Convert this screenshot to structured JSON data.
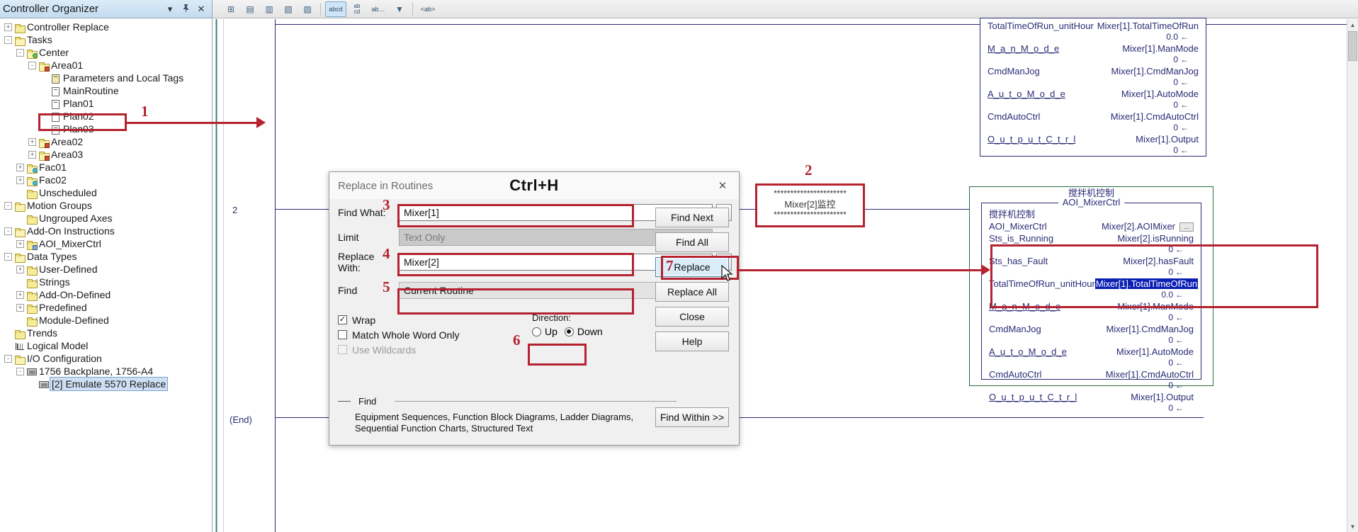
{
  "organizer": {
    "title": "Controller Organizer",
    "title_icons": [
      {
        "name": "dropdown-icon",
        "glyph": "▾"
      },
      {
        "name": "pin-icon",
        "glyph": "📌"
      },
      {
        "name": "close-icon",
        "glyph": "✕"
      }
    ],
    "tree": [
      {
        "label": "Controller Replace",
        "depth": 0,
        "exp": "+",
        "icon": "folder",
        "sel": false
      },
      {
        "label": "Tasks",
        "depth": 0,
        "exp": "-",
        "icon": "folder-open",
        "sel": false
      },
      {
        "label": "Center",
        "depth": 1,
        "exp": "-",
        "icon": "folder-task",
        "sel": false
      },
      {
        "label": "Area01",
        "depth": 2,
        "exp": "-",
        "icon": "folder-program",
        "sel": false
      },
      {
        "label": "Parameters and Local Tags",
        "depth": 3,
        "exp": "",
        "icon": "params",
        "sel": false
      },
      {
        "label": "MainRoutine",
        "depth": 3,
        "exp": "",
        "icon": "routine-main",
        "sel": false
      },
      {
        "label": "Plan01",
        "depth": 3,
        "exp": "",
        "icon": "routine",
        "sel": false
      },
      {
        "label": "Plan02",
        "depth": 3,
        "exp": "",
        "icon": "routine",
        "sel": false
      },
      {
        "label": "Plan03",
        "depth": 3,
        "exp": "",
        "icon": "routine",
        "sel": false
      },
      {
        "label": "Area02",
        "depth": 2,
        "exp": "+",
        "icon": "folder-program",
        "sel": false
      },
      {
        "label": "Area03",
        "depth": 2,
        "exp": "+",
        "icon": "folder-program",
        "sel": false
      },
      {
        "label": "Fac01",
        "depth": 1,
        "exp": "+",
        "icon": "folder-equip",
        "sel": false
      },
      {
        "label": "Fac02",
        "depth": 1,
        "exp": "+",
        "icon": "folder-equip",
        "sel": false
      },
      {
        "label": "Unscheduled",
        "depth": 1,
        "exp": "",
        "icon": "folder",
        "sel": false
      },
      {
        "label": "Motion Groups",
        "depth": 0,
        "exp": "-",
        "icon": "folder-open",
        "sel": false
      },
      {
        "label": "Ungrouped Axes",
        "depth": 1,
        "exp": "",
        "icon": "folder",
        "sel": false
      },
      {
        "label": "Add-On Instructions",
        "depth": 0,
        "exp": "-",
        "icon": "folder-open",
        "sel": false
      },
      {
        "label": "AOI_MixerCtrl",
        "depth": 1,
        "exp": "+",
        "icon": "aoi",
        "sel": false
      },
      {
        "label": "Data Types",
        "depth": 0,
        "exp": "-",
        "icon": "folder-open",
        "sel": false
      },
      {
        "label": "User-Defined",
        "depth": 1,
        "exp": "+",
        "icon": "folder-dt",
        "sel": false
      },
      {
        "label": "Strings",
        "depth": 1,
        "exp": "",
        "icon": "folder-dt",
        "sel": false
      },
      {
        "label": "Add-On-Defined",
        "depth": 1,
        "exp": "+",
        "icon": "folder-dt",
        "sel": false
      },
      {
        "label": "Predefined",
        "depth": 1,
        "exp": "+",
        "icon": "folder-dt",
        "sel": false
      },
      {
        "label": "Module-Defined",
        "depth": 1,
        "exp": "",
        "icon": "folder-dt",
        "sel": false
      },
      {
        "label": "Trends",
        "depth": 0,
        "exp": "",
        "icon": "folder",
        "sel": false
      },
      {
        "label": "Logical Model",
        "depth": 0,
        "exp": "",
        "icon": "logical",
        "sel": false
      },
      {
        "label": "I/O Configuration",
        "depth": 0,
        "exp": "-",
        "icon": "folder-open",
        "sel": false
      },
      {
        "label": "1756 Backplane, 1756-A4",
        "depth": 1,
        "exp": "-",
        "icon": "chip",
        "sel": false
      },
      {
        "label": "[2] Emulate 5570 Replace",
        "depth": 2,
        "exp": "",
        "icon": "chip",
        "sel": true
      }
    ]
  },
  "toolbar": {
    "buttons": [
      {
        "name": "branch-icon",
        "glyph": "⊞",
        "active": false
      },
      {
        "name": "rung-insert-icon",
        "glyph": "▤",
        "active": false
      },
      {
        "name": "rung-append-icon",
        "glyph": "▥",
        "active": false
      },
      {
        "name": "branch-level-icon",
        "glyph": "▧",
        "active": false
      },
      {
        "name": "branch-extend-icon",
        "glyph": "▨",
        "active": false
      },
      {
        "name": "abcd-icon",
        "glyph": "abcd",
        "active": true
      },
      {
        "name": "ab-cd-icon",
        "glyph": "ab\ncd",
        "active": false
      },
      {
        "name": "ab-ellipsis-icon",
        "glyph": "ab…",
        "active": false
      },
      {
        "name": "dropdown-arrow-icon",
        "glyph": "▼",
        "active": false
      },
      {
        "name": "tag-brackets-icon",
        "glyph": "<ab>",
        "active": false
      }
    ]
  },
  "editor": {
    "rung_number": "2",
    "end_label": "(End)"
  },
  "ladder": {
    "top_block": {
      "rows": [
        {
          "name": "TotalTimeOfRun_unitHour",
          "tag": "Mixer[1].TotalTimeOfRun",
          "value": "0.0",
          "underline": false,
          "clipped": true
        },
        {
          "name": "M_a_n_M_o_d_e",
          "tag": "Mixer[1].ManMode",
          "value": "0",
          "underline": true
        },
        {
          "name": "CmdManJog",
          "tag": "Mixer[1].CmdManJog",
          "value": "0",
          "underline": false
        },
        {
          "name": "A_u_t_o_M_o_d_e",
          "tag": "Mixer[1].AutoMode",
          "value": "0",
          "underline": true
        },
        {
          "name": "CmdAutoCtrl",
          "tag": "Mixer[1].CmdAutoCtrl",
          "value": "0",
          "underline": false
        },
        {
          "name": "O_u_t_p_u_t_C_t_r_l",
          "tag": "Mixer[1].Output",
          "value": "0",
          "underline": true
        }
      ]
    },
    "bottom_block": {
      "title_cn": "搅拌机控制",
      "instruction_caption": "AOI_MixerCtrl",
      "desc_cn": "搅拌机控制",
      "rows": [
        {
          "name": "AOI_MixerCtrl",
          "tag": "Mixer[2].AOIMixer",
          "value": "",
          "underline": false,
          "has_dots": true
        },
        {
          "name": "Sts_is_Running",
          "tag": "Mixer[2].isRunning",
          "value": "0",
          "underline": false
        },
        {
          "name": "Sts_has_Fault",
          "tag": "Mixer[2].hasFault",
          "value": "0",
          "underline": false
        },
        {
          "name": "TotalTimeOfRun_unitHour",
          "tag": "Mixer[1].TotalTimeOfRun",
          "value": "0.0",
          "underline": false,
          "highlight": true
        },
        {
          "name": "M_a_n_M_o_d_e",
          "tag": "Mixer[1].ManMode",
          "value": "0",
          "underline": true
        },
        {
          "name": "CmdManJog",
          "tag": "Mixer[1].CmdManJog",
          "value": "0",
          "underline": false
        },
        {
          "name": "A_u_t_o_M_o_d_e",
          "tag": "Mixer[1].AutoMode",
          "value": "0",
          "underline": true
        },
        {
          "name": "CmdAutoCtrl",
          "tag": "Mixer[1].CmdAutoCtrl",
          "value": "0",
          "underline": false
        },
        {
          "name": "O_u_t_p_u_t_C_t_r_l",
          "tag": "Mixer[1].Output",
          "value": "0",
          "underline": true
        }
      ]
    }
  },
  "dialog": {
    "title": "Replace in Routines",
    "shortcut": "Ctrl+H",
    "close_glyph": "✕",
    "find_what": {
      "label": "Find What:",
      "value": "Mixer[1]",
      "caret": "⌄",
      "browse": "..."
    },
    "limit": {
      "label": "Limit",
      "value": "Text Only",
      "caret": "⌄"
    },
    "replace_with": {
      "label": "Replace With:",
      "value": "Mixer[2]",
      "caret": "⌄",
      "browse": "..."
    },
    "find_scope": {
      "label": "Find",
      "value": "Current Routine",
      "caret": "⌄"
    },
    "checkboxes": [
      {
        "label": "Wrap",
        "checked": true,
        "enabled": true,
        "check_glyph": "✓"
      },
      {
        "label": "Match Whole Word Only",
        "checked": false,
        "enabled": true,
        "check_glyph": ""
      },
      {
        "label": "Use Wildcards",
        "checked": false,
        "enabled": false,
        "check_glyph": ""
      }
    ],
    "direction": {
      "label": "Direction:",
      "options": [
        {
          "label": "Up",
          "selected": false
        },
        {
          "label": "Down",
          "selected": true
        }
      ]
    },
    "group": {
      "label": "Find",
      "line1": "Equipment Sequences, Function Block Diagrams, Ladder Diagrams,",
      "line2": "Sequential Function Charts, Structured Text"
    },
    "buttons": [
      {
        "name": "find-next-button",
        "label": "Find Next",
        "focus": false
      },
      {
        "name": "find-all-button",
        "label": "Find All",
        "focus": false
      },
      {
        "name": "replace-button",
        "label": "Replace",
        "focus": true
      },
      {
        "name": "replace-all-button",
        "label": "Replace All",
        "focus": false
      },
      {
        "name": "close-button",
        "label": "Close",
        "focus": false
      },
      {
        "name": "help-button",
        "label": "Help",
        "focus": false
      },
      {
        "name": "find-within-button",
        "label": "Find Within >>",
        "focus": false
      }
    ]
  },
  "annotations": {
    "step1": "1",
    "step2": "2",
    "step3": "3",
    "step4": "4",
    "step5": "5",
    "step6": "6",
    "step7": "7",
    "note": {
      "top_stars": "**********************",
      "text": "Mixer[2]监控",
      "bottom_stars": "**********************"
    },
    "accent_color": "#b52230"
  }
}
